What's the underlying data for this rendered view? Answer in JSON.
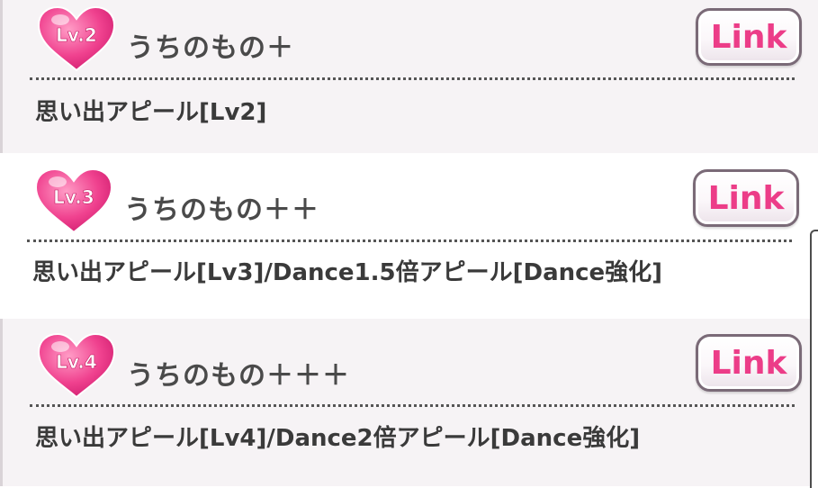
{
  "skills": [
    {
      "level_badge": "Lv.2",
      "name": "うちのもの＋",
      "link_label": "Link",
      "description": "思い出アピール[Lv2]"
    },
    {
      "level_badge": "Lv.3",
      "name": "うちのもの＋＋",
      "link_label": "Link",
      "description": "思い出アピール[Lv3]/Dance1.5倍アピール[Dance強化]"
    },
    {
      "level_badge": "Lv.4",
      "name": "うちのもの＋＋＋",
      "link_label": "Link",
      "description": "思い出アピール[Lv4]/Dance2倍アピール[Dance強化]"
    }
  ],
  "colors": {
    "heart_pink": "#ef3f8e",
    "link_text": "#ec3d88",
    "panel_alt": "#f6f3f5"
  }
}
